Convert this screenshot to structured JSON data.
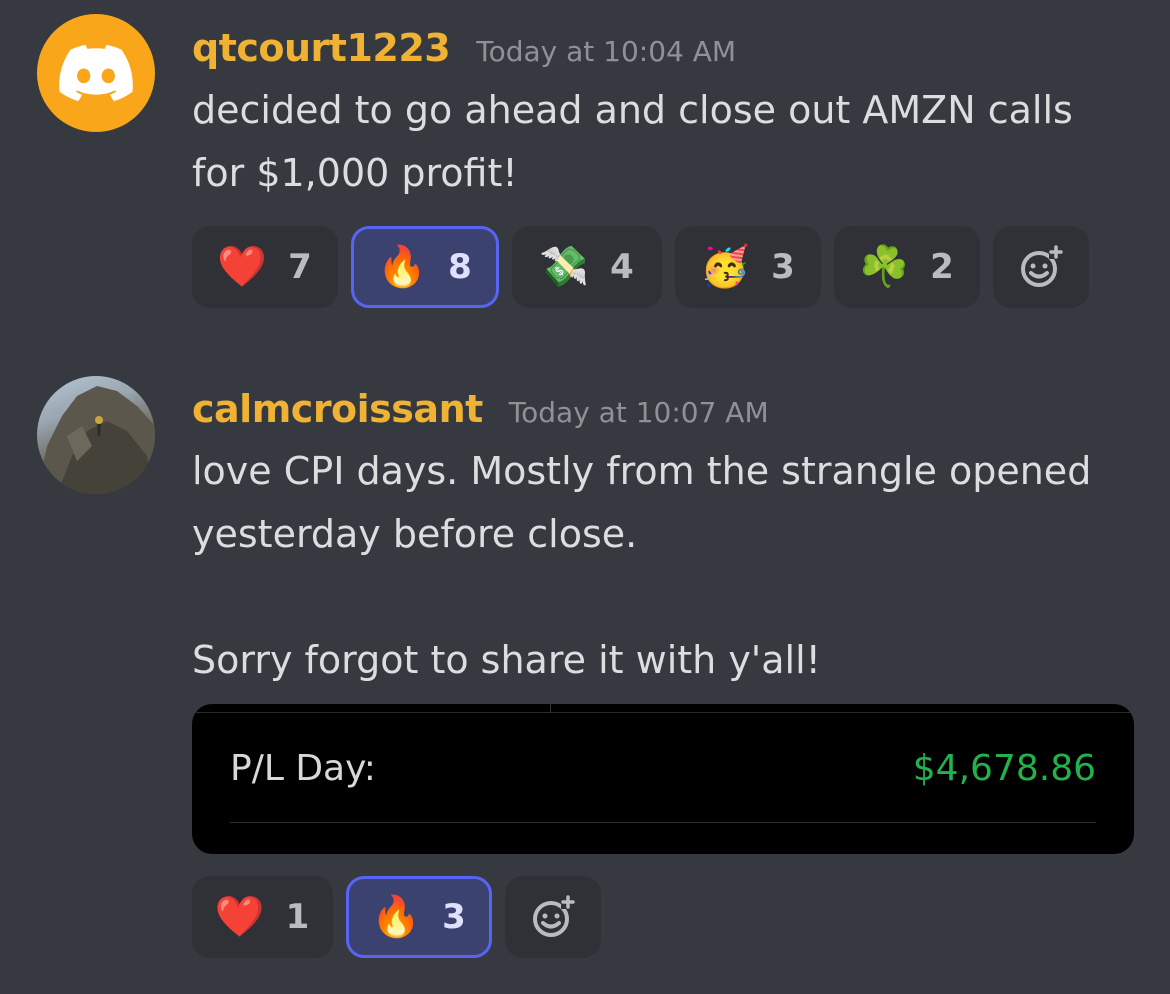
{
  "messages": [
    {
      "avatar": "discord-logo-icon",
      "username": "qtcourt1223",
      "timestamp": "Today at 10:04 AM",
      "lines": [
        "decided to go ahead and close out AMZN calls",
        "for $1,000 profit!"
      ],
      "reactions": [
        {
          "emoji": "❤️",
          "icon": "heart-icon",
          "count": "7",
          "active": false
        },
        {
          "emoji": "🔥",
          "icon": "fire-icon",
          "count": "8",
          "active": true
        },
        {
          "emoji": "💸",
          "icon": "money-with-wings-icon",
          "count": "4",
          "active": false
        },
        {
          "emoji": "🥳",
          "icon": "partying-face-icon",
          "count": "3",
          "active": false
        },
        {
          "emoji": "☘️",
          "icon": "shamrock-icon",
          "count": "2",
          "active": false
        }
      ]
    },
    {
      "avatar": "user-photo-avatar",
      "username": "calmcroissant",
      "timestamp": "Today at 10:07 AM",
      "lines": [
        "love CPI days. Mostly from the strangle opened",
        "yesterday before close.",
        "",
        "Sorry forgot to share it with y'all!"
      ],
      "attachment": {
        "label": "P/L Day:",
        "value": "$4,678.86",
        "value_color": "#22b14c"
      },
      "reactions": [
        {
          "emoji": "❤️",
          "icon": "heart-icon",
          "count": "1",
          "active": false
        },
        {
          "emoji": "🔥",
          "icon": "fire-icon",
          "count": "3",
          "active": true
        }
      ]
    }
  ],
  "colors": {
    "background": "#36393f",
    "username": "#f0b232",
    "reaction_active_border": "#5865f2"
  }
}
